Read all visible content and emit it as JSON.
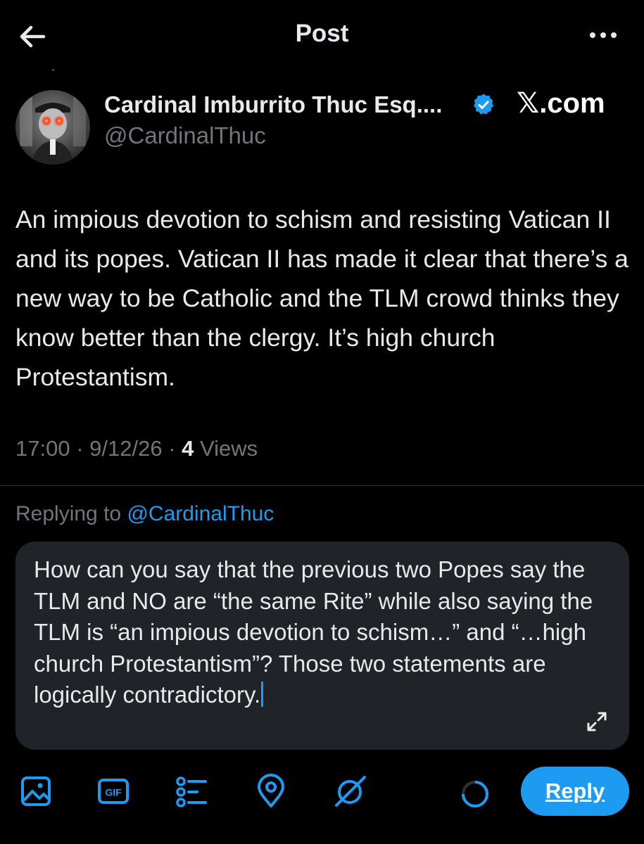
{
  "header": {
    "title": "Post",
    "back_icon": "arrow-left-icon",
    "more_icon": "more-horizontal-icon"
  },
  "author": {
    "display_name": "Cardinal Imburrito Thuc Esq....",
    "handle": "@CardinalThuc",
    "verified": true,
    "watermark": "𝕏.com"
  },
  "post": {
    "text": "An impious devotion to schism and resisting Vatican II and its popes. Vatican II has made it clear that there’s a new way to be Catholic and the TLM crowd thinks they know better than the clergy. It’s high church Protestantism.",
    "time": "17:00",
    "date": "9/12/26",
    "views_count": "4",
    "views_label": "Views"
  },
  "reply": {
    "replying_prefix": "Replying to",
    "replying_handle": "@CardinalThuc",
    "draft_text": "How can you say that the previous two Popes say the TLM and NO are “the same Rite” while also saying the TLM is “an impious devotion to schism…” and “…high church Protestantism”? Those two statements are logically contradictory.",
    "button_label": "Reply"
  },
  "toolbar": {
    "icons": [
      "image-icon",
      "gif-icon",
      "poll-icon",
      "location-icon",
      "grok-icon"
    ]
  },
  "colors": {
    "accent": "#1d9bf0",
    "background": "#000000",
    "secondary_text": "#71767b",
    "composer_bg": "#202327"
  }
}
